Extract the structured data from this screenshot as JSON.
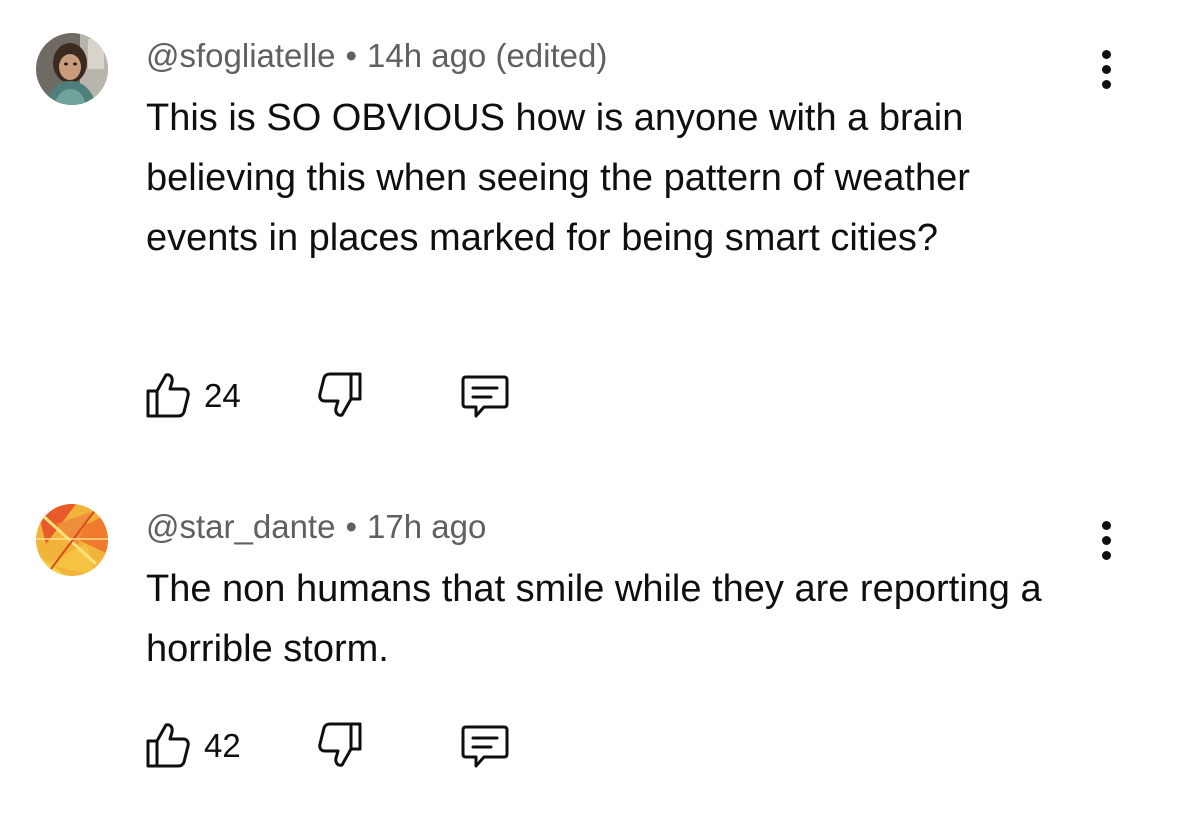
{
  "comments": [
    {
      "handle": "@sfogliatelle",
      "separator": "•",
      "time": "14h ago (edited)",
      "text": "This is SO OBVIOUS how is anyone with a brain believing this when seeing the pattern of weather events in places marked for being smart cities?",
      "likes": "24",
      "avatar": "portrait-photo"
    },
    {
      "handle": "@star_dante",
      "separator": "•",
      "time": "17h ago",
      "text": "The non humans that smile while they are reporting a horrible storm.",
      "likes": "42",
      "avatar": "orange-yellow-abstract"
    }
  ],
  "icons": {
    "like": "thumbs-up-icon",
    "dislike": "thumbs-down-icon",
    "reply": "reply-comment-icon",
    "more": "more-vertical-icon"
  }
}
